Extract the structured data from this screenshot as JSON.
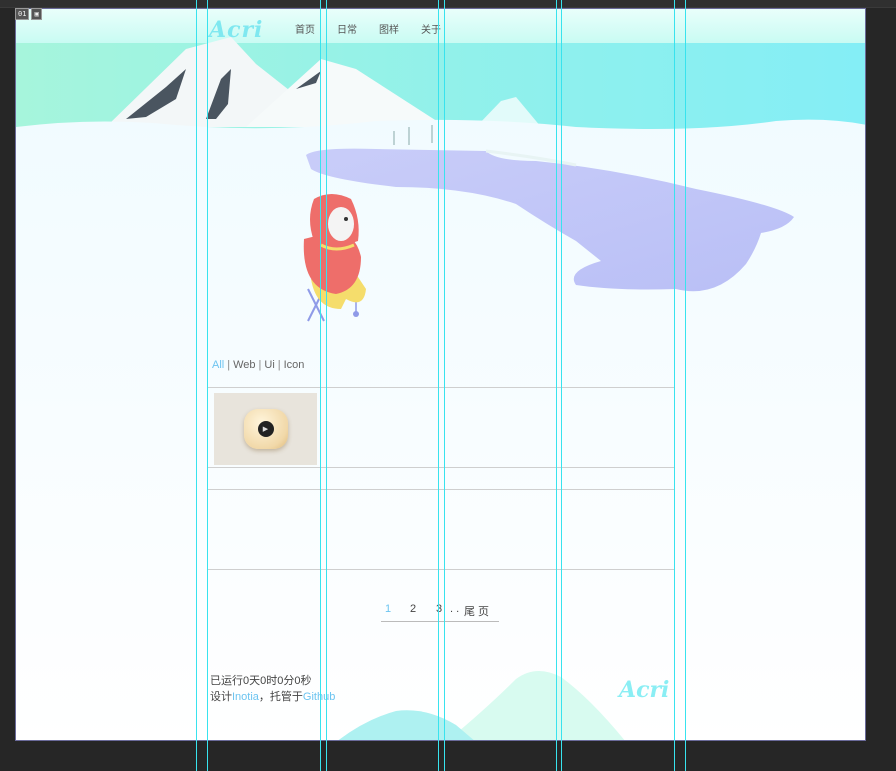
{
  "artboard": {
    "number": "01",
    "icon": "image-icon"
  },
  "site": {
    "logo": "Acri"
  },
  "nav": [
    {
      "label": "首页"
    },
    {
      "label": "日常"
    },
    {
      "label": "图样"
    },
    {
      "label": "关于"
    }
  ],
  "filters": [
    {
      "label": "All",
      "active": true
    },
    {
      "label": "Web",
      "active": false
    },
    {
      "label": "Ui",
      "active": false
    },
    {
      "label": "Icon",
      "active": false
    }
  ],
  "pagination": {
    "pages": [
      "1",
      "2",
      "3"
    ],
    "ellipsis": ". .",
    "last": "尾 页",
    "current": "1"
  },
  "footer": {
    "runtime": "已运行0天0时0分0秒",
    "design_prefix": "设计",
    "designer": "Inotia",
    "hosted_prefix": "，托管于",
    "host": "Github",
    "logo": "Acri"
  },
  "colors": {
    "accent": "#6cc4f0",
    "guide": "#38e3ee",
    "lake": "#c4c8f8",
    "sky": "#8ff0f0"
  }
}
